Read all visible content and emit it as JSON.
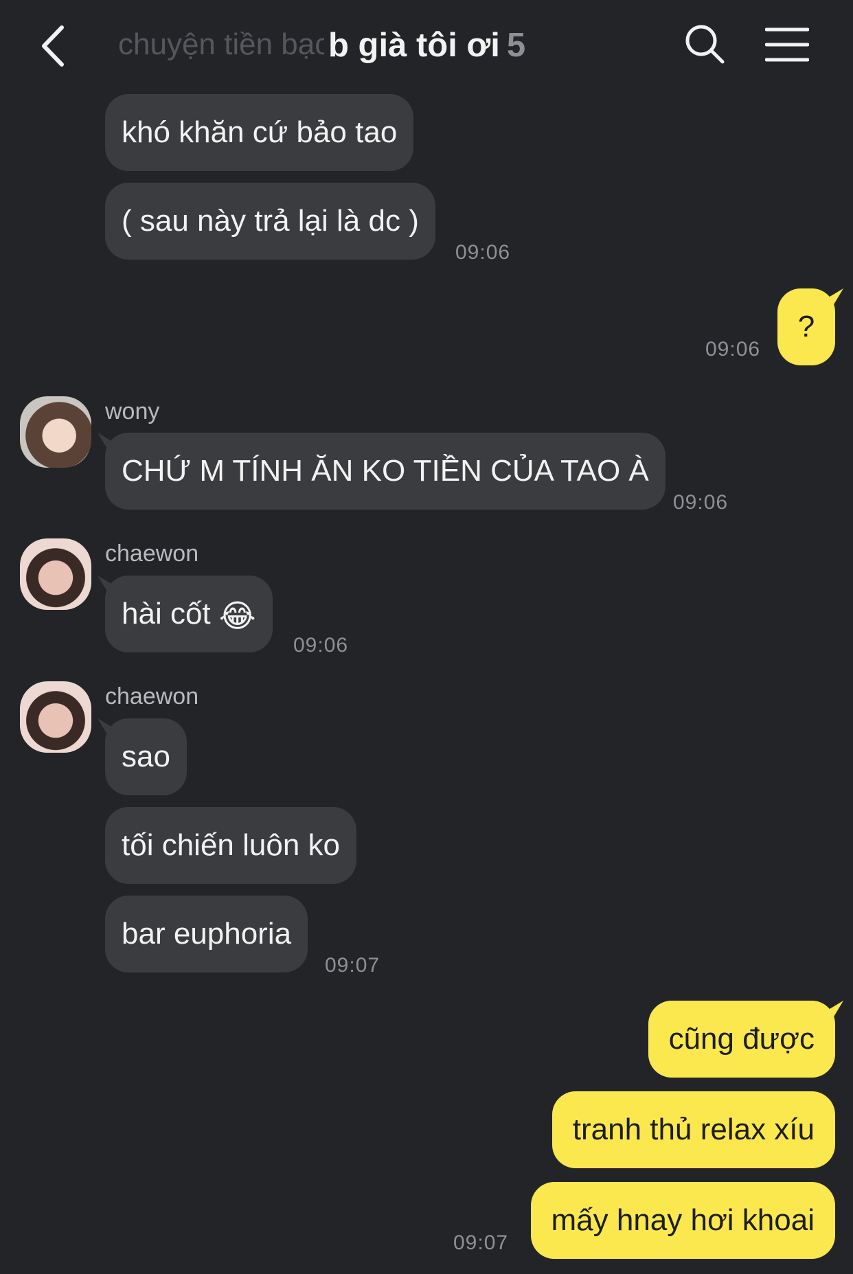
{
  "header": {
    "ghost_title": "chuyện tiền bạc",
    "title": "b già tôi ơi",
    "member_count": "5"
  },
  "messages": {
    "m1": "khó khăn cứ bảo tao",
    "m2": "( sau này trả lại là dc )",
    "m2_time": "09:06",
    "m3": "?",
    "m3_time": "09:06",
    "wony_name": "wony",
    "m4": "CHỨ M TÍNH ĂN KO TIỀN CỦA TAO À",
    "m4_time": "09:06",
    "chaewon_name_1": "chaewon",
    "m5": "hài cốt",
    "m5_emoji": "😂",
    "m5_time": "09:06",
    "chaewon_name_2": "chaewon",
    "m6": "sao",
    "m7": "tối chiến luôn ko",
    "m8": "bar euphoria",
    "m8_time": "09:07",
    "m9": "cũng được",
    "m10": "tranh thủ relax xíu",
    "m11": "mấy hnay hơi khoai",
    "m11_time": "09:07"
  },
  "colors": {
    "background": "#232427",
    "incoming_bubble": "#3b3c40",
    "outgoing_bubble": "#fae84e"
  },
  "icons": [
    "back-arrow-icon",
    "search-icon",
    "menu-icon"
  ]
}
